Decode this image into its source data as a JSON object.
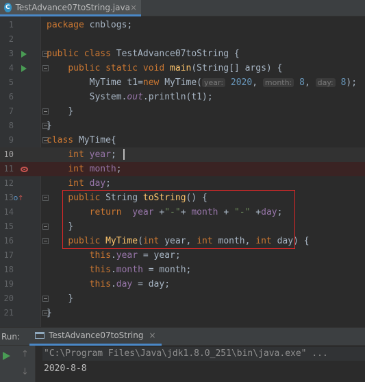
{
  "tab": {
    "icon": "C",
    "title": "TestAdvance07toString.java",
    "close": "×"
  },
  "colors": {
    "keyword": "#cc7832",
    "function": "#ffc66d",
    "number": "#6897bb",
    "string": "#6a8759",
    "field": "#9876aa",
    "text": "#a9b7c6",
    "highlight_box": "#e02828"
  },
  "editor": {
    "line_numbers": [
      "1",
      "2",
      "3",
      "4",
      "5",
      "6",
      "7",
      "8",
      "9",
      "10",
      "11",
      "12",
      "13",
      "14",
      "15",
      "16",
      "17",
      "18",
      "19",
      "20",
      "21"
    ],
    "code": {
      "l1": {
        "kw": "package",
        "rest": " cnblogs;"
      },
      "l3": {
        "kw": "public class",
        "name": " TestAdvance07toString {"
      },
      "l4": {
        "kw1": "public static void",
        "fn": "main",
        "rest": "(String[] args) {"
      },
      "l5": {
        "a": "MyTime t1=",
        "kw": "new",
        "b": " MyTime(",
        "h1": "year:",
        "n1": "2020",
        "c1": ", ",
        "h2": "month:",
        "n2": "8",
        "c2": ", ",
        "h3": "day:",
        "n3": "8",
        "end": ");"
      },
      "l6": {
        "a": "System.",
        "out": "out",
        "b": ".println(t1);"
      },
      "l7": "}",
      "l8": "}",
      "l9": {
        "kw": "class",
        "rest": " MyTime{"
      },
      "l10": {
        "kw": "int",
        "f": "year",
        "end": ";"
      },
      "l11": {
        "kw": "int",
        "f": "month",
        "end": ";"
      },
      "l12": {
        "kw": "int",
        "f": "day",
        "end": ";"
      },
      "l13": {
        "kw": "public",
        "type": " String ",
        "fn": "toString",
        "rest": "() {"
      },
      "l14": {
        "kw": "return",
        "f1": "year",
        "op1": " +",
        "s1": "\"-\"",
        "op2": "+ ",
        "f2": "month",
        "op3": " + ",
        "s2": "\"-\"",
        "op4": " +",
        "f3": "day",
        "end": ";"
      },
      "l15": "}",
      "l16": {
        "kw": "public",
        "fn": "MyTime",
        "p1": "(",
        "k1": "int",
        "a1": " year, ",
        "k2": "int",
        "a2": " month, ",
        "k3": "int",
        "a3": " day) {"
      },
      "l17": {
        "kw": "this",
        "dot": ".",
        "f": "year",
        "rest": " = year;"
      },
      "l18": {
        "kw": "this",
        "dot": ".",
        "f": "month",
        "rest": " = month;"
      },
      "l19": {
        "kw": "this",
        "dot": ".",
        "f": "day",
        "rest": " = day;"
      },
      "l20": "}",
      "l21": "}"
    }
  },
  "run_panel": {
    "label": "Run:",
    "tab_label": "TestAdvance07toString",
    "tab_close": "×"
  },
  "console": {
    "command": "\"C:\\Program Files\\Java\\jdk1.8.0_251\\bin\\java.exe\" ...",
    "output": "2020-8-8"
  },
  "gutter_icons": {
    "run_line3": "run-icon",
    "run_line4": "run-icon",
    "breakpoint_line11": "breakpoint-icon",
    "override_line13": "override-icon"
  }
}
